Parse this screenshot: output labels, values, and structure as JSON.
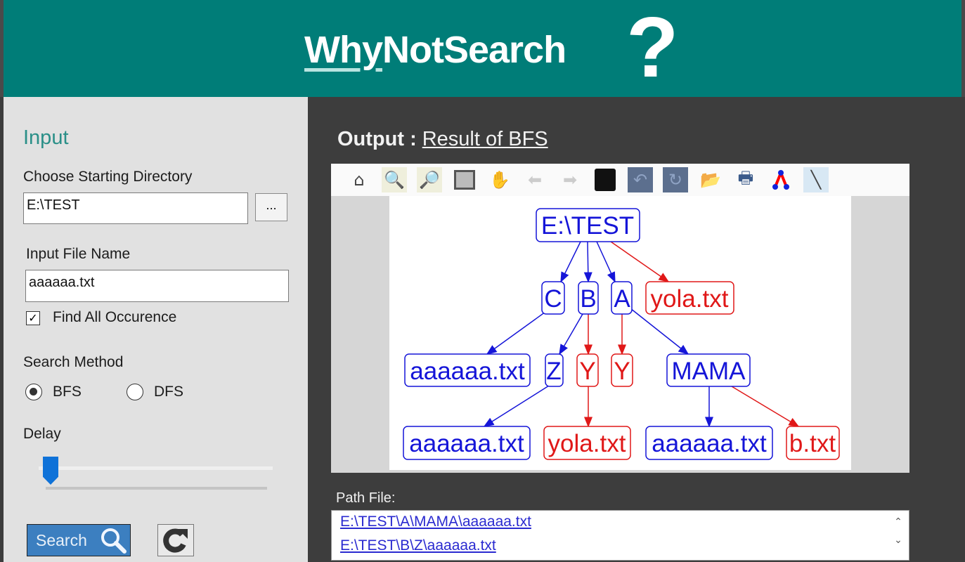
{
  "header": {
    "logo_text_1": "Why",
    "logo_text_2": "NotSearch",
    "logo_mark": "?"
  },
  "input": {
    "title": "Input",
    "dir_label": "Choose Starting Directory",
    "dir_value": "E:\\TEST",
    "browse_label": "...",
    "file_label": "Input File Name",
    "file_value": "aaaaaa.txt",
    "find_all_label": "Find All Occurence",
    "find_all_checked": true,
    "method_label": "Search Method",
    "methods": [
      "BFS",
      "DFS"
    ],
    "method_selected": "BFS",
    "delay_label": "Delay",
    "delay_value": 0,
    "search_label": "Search"
  },
  "output": {
    "title": "Output :",
    "subtitle": "Result of BFS",
    "toolbar": [
      "home-icon",
      "zoom-in-icon",
      "zoom-out-icon",
      "fit-page-icon",
      "pan-hand-icon",
      "back-arrow-icon",
      "forward-arrow-icon",
      "save-icon",
      "undo-icon",
      "redo-icon",
      "open-folder-icon",
      "print-icon",
      "layout-graph-icon",
      "draw-edge-icon"
    ],
    "graph": {
      "nodes": {
        "root": "E:\\TEST",
        "c": "C",
        "b": "B",
        "a": "A",
        "yola1": "yola.txt",
        "aaa1": "aaaaaa.txt",
        "z": "Z",
        "y1": "Y",
        "y2": "Y",
        "mama": "MAMA",
        "aaa2": "aaaaaa.txt",
        "yola2": "yola.txt",
        "aaa3": "aaaaaa.txt",
        "btxt": "b.txt"
      },
      "colors": {
        "found": "#1515d8",
        "not_found": "#e01818"
      }
    },
    "path_label": "Path File:",
    "paths": [
      "E:\\TEST\\A\\MAMA\\aaaaaa.txt",
      "E:\\TEST\\B\\Z\\aaaaaa.txt"
    ]
  }
}
